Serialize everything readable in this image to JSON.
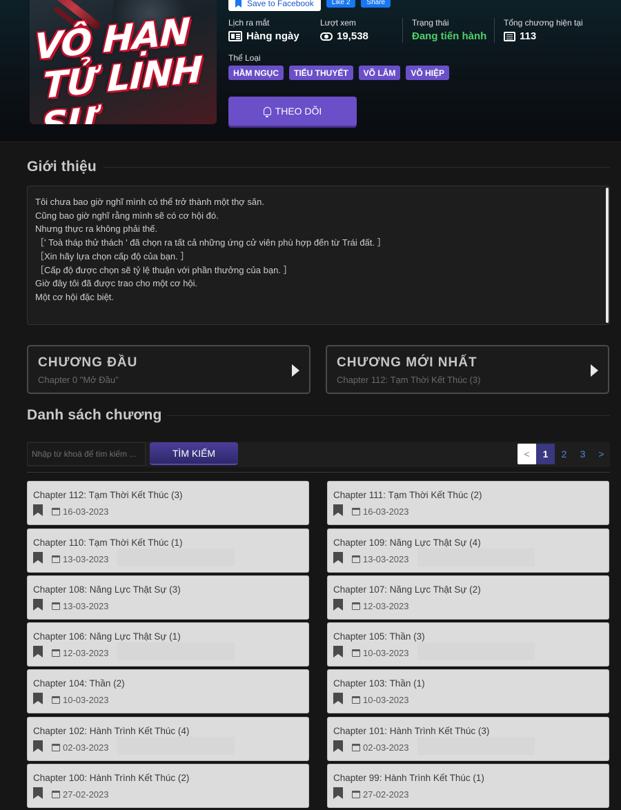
{
  "cover": {
    "title_line1": "VÔ HẠN",
    "title_line2": "TỬ LINH SƯ"
  },
  "facebook": {
    "save_label": "Save to Facebook",
    "like_label": "Like 2",
    "share_label": "Share"
  },
  "meta": {
    "schedule": {
      "label": "Lịch ra mắt",
      "value": "Hàng ngày"
    },
    "views": {
      "label": "Lượt xem",
      "value": "19,538"
    },
    "status": {
      "label": "Trạng thái",
      "value": "Đang tiến hành"
    },
    "chapters": {
      "label": "Tổng chương hiện tại",
      "value": "113"
    }
  },
  "genres": {
    "label": "Thể Loại",
    "items": [
      "HẦM NGỤC",
      "TIỂU THUYẾT",
      "VÕ LÂM",
      "VÕ HIỆP"
    ]
  },
  "follow_label": "THEO DÕI",
  "intro": {
    "title": "Giới thiệu",
    "lines": [
      "Tôi chưa bao giờ nghĩ mình có thể trở thành một thợ săn.",
      "Cũng bao giờ nghĩ rằng mình sẽ có cơ hội đó.",
      "Nhưng thực ra không phải thế.",
      "［' Toà tháp thử thách ' đã chọn ra tất cả những ứng cử viên phù hợp đến từ Trái đất. ］",
      "［Xin hãy lựa chọn cấp độ của bạn. ］",
      "［Cấp độ được chọn sẽ tỷ lệ thuận với phần thưởng của bạn. ］",
      "Giờ đây tôi đã được trao cho một cơ hội.",
      "Một cơ hội đặc biệt."
    ]
  },
  "first_chapter": {
    "title": "CHƯƠNG ĐẦU",
    "subtitle": "Chapter 0 \"Mở Đầu\""
  },
  "latest_chapter": {
    "title": "CHƯƠNG MỚI NHẤT",
    "subtitle": "Chapter 112: Tạm Thời Kết Thúc (3)"
  },
  "chapter_list": {
    "title": "Danh sách chương",
    "search_placeholder": "Nhập từ khoá để tìm kiếm ...",
    "search_button": "TÌM KIẾM",
    "pagination": {
      "prev": "<",
      "pages": [
        "1",
        "2",
        "3"
      ],
      "current": "1",
      "next": ">"
    },
    "items": [
      {
        "name": "Chapter 112: Tạm Thời Kết Thúc (3)",
        "date": "16-03-2023"
      },
      {
        "name": "Chapter 111: Tạm Thời Kết Thúc (2)",
        "date": "16-03-2023"
      },
      {
        "name": "Chapter 110: Tạm Thời Kết Thúc (1)",
        "date": "13-03-2023"
      },
      {
        "name": "Chapter 109: Năng Lực Thật Sự (4)",
        "date": "13-03-2023"
      },
      {
        "name": "Chapter 108: Năng Lực Thật Sự (3)",
        "date": "13-03-2023"
      },
      {
        "name": "Chapter 107: Năng Lực Thật Sự (2)",
        "date": "12-03-2023"
      },
      {
        "name": "Chapter 106: Năng Lực Thật Sự (1)",
        "date": "12-03-2023"
      },
      {
        "name": "Chapter 105: Thần (3)",
        "date": "10-03-2023"
      },
      {
        "name": "Chapter 104: Thần (2)",
        "date": "10-03-2023"
      },
      {
        "name": "Chapter 103: Thần (1)",
        "date": "10-03-2023"
      },
      {
        "name": "Chapter 102: Hành Trình Kết Thúc (4)",
        "date": "02-03-2023"
      },
      {
        "name": "Chapter 101: Hành Trình Kết Thúc (3)",
        "date": "02-03-2023"
      },
      {
        "name": "Chapter 100: Hành Trình Kết Thúc (2)",
        "date": "27-02-2023"
      },
      {
        "name": "Chapter 99: Hành Trình Kết Thúc (1)",
        "date": "27-02-2023"
      }
    ]
  },
  "colors": {
    "accent": "#6a4fc8",
    "status_green": "#4dd06a",
    "page_bg": "#161616",
    "card_bg": "#dcdcdc"
  }
}
